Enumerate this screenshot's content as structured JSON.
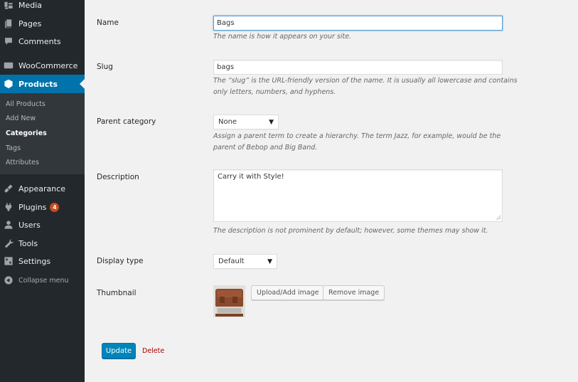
{
  "sidebar": {
    "items": [
      {
        "label": "Media",
        "icon": "media-icon"
      },
      {
        "label": "Pages",
        "icon": "pages-icon"
      },
      {
        "label": "Comments",
        "icon": "comments-icon"
      },
      {
        "label": "WooCommerce",
        "icon": "woocommerce-icon"
      },
      {
        "label": "Products",
        "icon": "products-icon",
        "active": true
      },
      {
        "label": "Appearance",
        "icon": "appearance-icon"
      },
      {
        "label": "Plugins",
        "icon": "plugins-icon",
        "badge": "4"
      },
      {
        "label": "Users",
        "icon": "users-icon"
      },
      {
        "label": "Tools",
        "icon": "tools-icon"
      },
      {
        "label": "Settings",
        "icon": "settings-icon"
      }
    ],
    "submenu": [
      {
        "label": "All Products"
      },
      {
        "label": "Add New"
      },
      {
        "label": "Categories",
        "current": true
      },
      {
        "label": "Tags"
      },
      {
        "label": "Attributes"
      }
    ],
    "collapse_label": "Collapse menu"
  },
  "form": {
    "name": {
      "label": "Name",
      "value": "Bags",
      "description": "The name is how it appears on your site."
    },
    "slug": {
      "label": "Slug",
      "value": "bags",
      "description": "The “slug” is the URL-friendly version of the name. It is usually all lowercase and contains only letters, numbers, and hyphens."
    },
    "parent": {
      "label": "Parent category",
      "selected": "None",
      "description": "Assign a parent term to create a hierarchy. The term Jazz, for example, would be the parent of Bebop and Big Band."
    },
    "description": {
      "label": "Description",
      "value": "Carry it with Style!",
      "description": "The description is not prominent by default; however, some themes may show it."
    },
    "display_type": {
      "label": "Display type",
      "selected": "Default"
    },
    "thumbnail": {
      "label": "Thumbnail",
      "upload_label": "Upload/Add image",
      "remove_label": "Remove image"
    },
    "update_label": "Update",
    "delete_label": "Delete"
  }
}
